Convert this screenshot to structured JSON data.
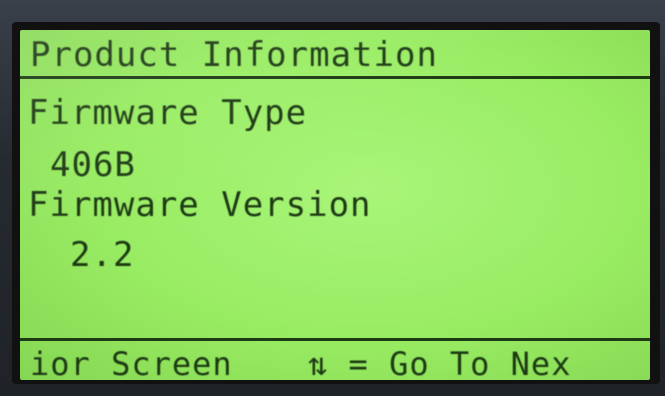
{
  "screen": {
    "title": "Product Information",
    "fields": [
      {
        "label": "Firmware Type",
        "value": "406B"
      },
      {
        "label": "Firmware Version",
        "value": "2.2"
      }
    ],
    "footer": {
      "left": "ior Screen",
      "right": "⇅ = Go To Nex"
    }
  },
  "colors": {
    "lcd_background": "#98ec62",
    "lcd_text": "#1d3a14",
    "bezel": "#2b3138"
  }
}
